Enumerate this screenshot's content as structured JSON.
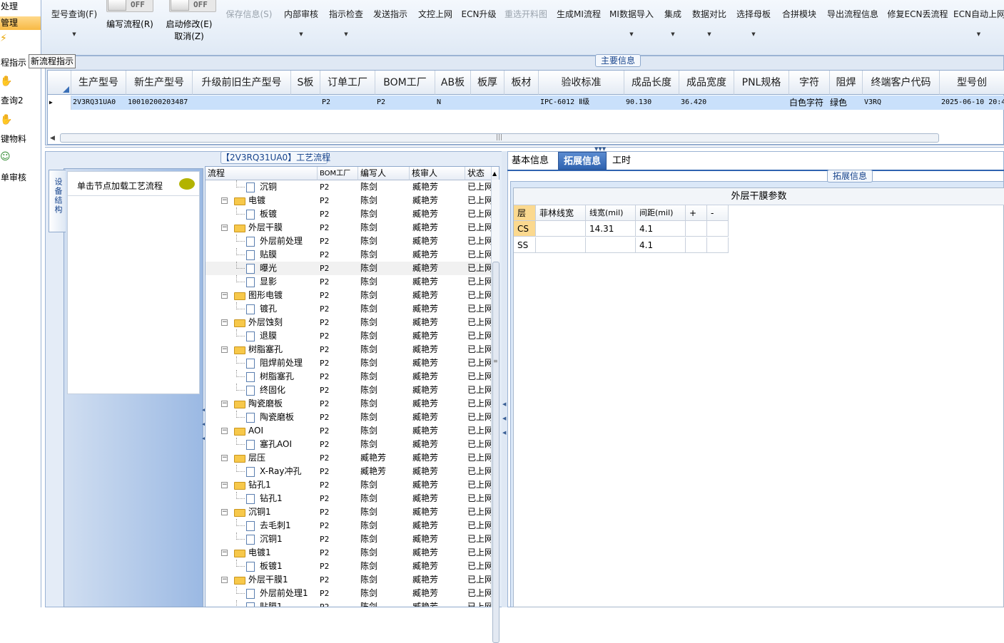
{
  "left_nav": {
    "items": [
      {
        "label": "处理"
      },
      {
        "label": "管理"
      },
      {
        "label": "程指示"
      },
      {
        "label": "查询2"
      },
      {
        "label": "键物料"
      },
      {
        "label": "单审核"
      }
    ]
  },
  "toolbar": {
    "buttons": [
      {
        "label": "型号查询(F)",
        "dropdown": true,
        "disabled": false
      },
      {
        "label": "保存信息(S)",
        "dropdown": false,
        "disabled": true
      },
      {
        "label": "内部审核",
        "dropdown": true,
        "disabled": false
      },
      {
        "label": "指示检查",
        "dropdown": true,
        "disabled": false
      },
      {
        "label": "发送指示",
        "dropdown": false,
        "disabled": false
      },
      {
        "label": "文控上网",
        "dropdown": false,
        "disabled": false
      },
      {
        "label": "ECN升级",
        "dropdown": false,
        "disabled": false
      },
      {
        "label": "重选开料图",
        "dropdown": false,
        "disabled": true
      },
      {
        "label": "生成MI流程",
        "dropdown": false,
        "disabled": false
      },
      {
        "label": "MI数据导入",
        "dropdown": true,
        "disabled": false
      },
      {
        "label": "集成",
        "dropdown": true,
        "disabled": false
      },
      {
        "label": "数据对比",
        "dropdown": true,
        "disabled": false
      },
      {
        "label": "选择母板",
        "dropdown": true,
        "disabled": false
      },
      {
        "label": "合拼模块",
        "dropdown": false,
        "disabled": false
      },
      {
        "label": "导出流程信息",
        "dropdown": false,
        "disabled": false
      },
      {
        "label": "修复ECN丢流程",
        "dropdown": false,
        "disabled": false
      },
      {
        "label": "ECN自动上网",
        "dropdown": true,
        "disabled": false
      }
    ],
    "toggle1": {
      "state": "OFF",
      "label": "编写流程(R)"
    },
    "toggle2": {
      "state": "OFF",
      "label": "启动修改(E)",
      "sub_label": "取消(Z)"
    }
  },
  "tooltip": {
    "text": "新流程指示"
  },
  "main_info": {
    "title": "主要信息",
    "columns": [
      "生产型号",
      "新生产型号",
      "升级前旧生产型号",
      "S板",
      "订单工厂",
      "BOM工厂",
      "AB板",
      "板厚",
      "板材",
      "验收标准",
      "成品长度",
      "成品宽度",
      "PNL规格",
      "字符",
      "阻焊",
      "终端客户代码",
      "型号创"
    ],
    "row": [
      "2V3RQ31UA0",
      "10010200203487",
      "",
      "",
      "P2",
      "P2",
      "N",
      "",
      "",
      "IPC-6012 Ⅱ级",
      "90.130",
      "36.420",
      "",
      "白色字符",
      "绿色",
      "V3RQ",
      "2025-06-10 20:4"
    ]
  },
  "process_panel": {
    "title": "【2V3RQ31UA0】工艺流程",
    "side_tab": "设备结构",
    "node_hint": "单击节点加载工艺流程",
    "columns": [
      "流程",
      "BOM工厂",
      "编写人",
      "核审人",
      "状态"
    ],
    "rows": [
      {
        "name": "沉铜",
        "level": 1,
        "factory": "P2",
        "writer": "陈剑",
        "reviewer": "臧艳芳",
        "status": "已上网"
      },
      {
        "name": "电镀",
        "level": 0,
        "factory": "P2",
        "writer": "陈剑",
        "reviewer": "臧艳芳",
        "status": "已上网"
      },
      {
        "name": "板镀",
        "level": 1,
        "factory": "P2",
        "writer": "陈剑",
        "reviewer": "臧艳芳",
        "status": "已上网"
      },
      {
        "name": "外层干膜",
        "level": 0,
        "factory": "P2",
        "writer": "陈剑",
        "reviewer": "臧艳芳",
        "status": "已上网"
      },
      {
        "name": "外层前处理",
        "level": 1,
        "factory": "P2",
        "writer": "陈剑",
        "reviewer": "臧艳芳",
        "status": "已上网"
      },
      {
        "name": "贴膜",
        "level": 1,
        "factory": "P2",
        "writer": "陈剑",
        "reviewer": "臧艳芳",
        "status": "已上网"
      },
      {
        "name": "曝光",
        "level": 1,
        "factory": "P2",
        "writer": "陈剑",
        "reviewer": "臧艳芳",
        "status": "已上网",
        "selected": true
      },
      {
        "name": "显影",
        "level": 1,
        "factory": "P2",
        "writer": "陈剑",
        "reviewer": "臧艳芳",
        "status": "已上网"
      },
      {
        "name": "图形电镀",
        "level": 0,
        "factory": "P2",
        "writer": "陈剑",
        "reviewer": "臧艳芳",
        "status": "已上网"
      },
      {
        "name": "镀孔",
        "level": 1,
        "factory": "P2",
        "writer": "陈剑",
        "reviewer": "臧艳芳",
        "status": "已上网"
      },
      {
        "name": "外层蚀刻",
        "level": 0,
        "factory": "P2",
        "writer": "陈剑",
        "reviewer": "臧艳芳",
        "status": "已上网"
      },
      {
        "name": "退膜",
        "level": 1,
        "factory": "P2",
        "writer": "陈剑",
        "reviewer": "臧艳芳",
        "status": "已上网"
      },
      {
        "name": "树脂塞孔",
        "level": 0,
        "factory": "P2",
        "writer": "陈剑",
        "reviewer": "臧艳芳",
        "status": "已上网"
      },
      {
        "name": "阻焊前处理",
        "level": 1,
        "factory": "P2",
        "writer": "陈剑",
        "reviewer": "臧艳芳",
        "status": "已上网"
      },
      {
        "name": "树脂塞孔",
        "level": 1,
        "factory": "P2",
        "writer": "陈剑",
        "reviewer": "臧艳芳",
        "status": "已上网"
      },
      {
        "name": "终固化",
        "level": 1,
        "factory": "P2",
        "writer": "陈剑",
        "reviewer": "臧艳芳",
        "status": "已上网"
      },
      {
        "name": "陶瓷磨板",
        "level": 0,
        "factory": "P2",
        "writer": "陈剑",
        "reviewer": "臧艳芳",
        "status": "已上网"
      },
      {
        "name": "陶瓷磨板",
        "level": 1,
        "factory": "P2",
        "writer": "陈剑",
        "reviewer": "臧艳芳",
        "status": "已上网"
      },
      {
        "name": "AOI",
        "level": 0,
        "factory": "P2",
        "writer": "陈剑",
        "reviewer": "臧艳芳",
        "status": "已上网"
      },
      {
        "name": "塞孔AOI",
        "level": 1,
        "factory": "P2",
        "writer": "陈剑",
        "reviewer": "臧艳芳",
        "status": "已上网"
      },
      {
        "name": "层压",
        "level": 0,
        "factory": "P2",
        "writer": "臧艳芳",
        "reviewer": "臧艳芳",
        "status": "已上网"
      },
      {
        "name": "X-Ray冲孔",
        "level": 1,
        "factory": "P2",
        "writer": "臧艳芳",
        "reviewer": "臧艳芳",
        "status": "已上网"
      },
      {
        "name": "钻孔1",
        "level": 0,
        "factory": "P2",
        "writer": "陈剑",
        "reviewer": "臧艳芳",
        "status": "已上网"
      },
      {
        "name": "钻孔1",
        "level": 1,
        "factory": "P2",
        "writer": "陈剑",
        "reviewer": "臧艳芳",
        "status": "已上网"
      },
      {
        "name": "沉铜1",
        "level": 0,
        "factory": "P2",
        "writer": "陈剑",
        "reviewer": "臧艳芳",
        "status": "已上网"
      },
      {
        "name": "去毛刺1",
        "level": 1,
        "factory": "P2",
        "writer": "陈剑",
        "reviewer": "臧艳芳",
        "status": "已上网"
      },
      {
        "name": "沉铜1",
        "level": 1,
        "factory": "P2",
        "writer": "陈剑",
        "reviewer": "臧艳芳",
        "status": "已上网"
      },
      {
        "name": "电镀1",
        "level": 0,
        "factory": "P2",
        "writer": "陈剑",
        "reviewer": "臧艳芳",
        "status": "已上网"
      },
      {
        "name": "板镀1",
        "level": 1,
        "factory": "P2",
        "writer": "陈剑",
        "reviewer": "臧艳芳",
        "status": "已上网"
      },
      {
        "name": "外层干膜1",
        "level": 0,
        "factory": "P2",
        "writer": "陈剑",
        "reviewer": "臧艳芳",
        "status": "已上网"
      },
      {
        "name": "外层前处理1",
        "level": 1,
        "factory": "P2",
        "writer": "陈剑",
        "reviewer": "臧艳芳",
        "status": "已上网"
      },
      {
        "name": "贴膜1",
        "level": 1,
        "factory": "P2",
        "writer": "陈剑",
        "reviewer": "臧艳芳",
        "status": "已上网"
      }
    ]
  },
  "right_panel": {
    "tabs": [
      {
        "label": "基本信息",
        "active": false
      },
      {
        "label": "拓展信息",
        "active": true
      },
      {
        "label": "工时",
        "active": false
      }
    ],
    "group_title": "拓展信息",
    "table_title": "外层干膜参数",
    "columns": [
      "层",
      "菲林线宽",
      "线宽(mil)",
      "间距(mil)",
      "+",
      "-"
    ],
    "rows": [
      [
        "CS",
        "",
        "14.31",
        "4.1",
        "",
        ""
      ],
      [
        "SS",
        "",
        "",
        "4.1",
        "",
        ""
      ]
    ]
  },
  "colors": {
    "accent": "#2f63b0",
    "row_selected": "#c9e0fb",
    "folder": "#f7c84a",
    "header_selected": "#fbd98f"
  }
}
